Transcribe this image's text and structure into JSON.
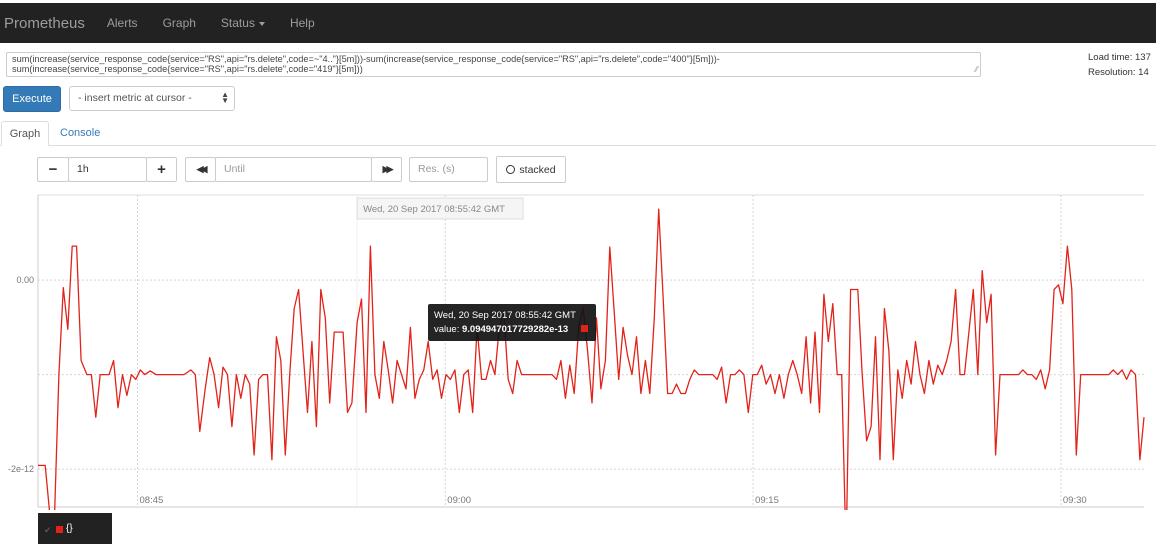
{
  "navbar": {
    "brand": "Prometheus",
    "items": [
      {
        "label": "Alerts"
      },
      {
        "label": "Graph"
      },
      {
        "label": "Status"
      },
      {
        "label": "Help"
      }
    ]
  },
  "query": {
    "line1": "sum(increase(service_response_code{service=\"RS\",api=\"rs.delete\",code=~\"4..\"}[5m]))-sum(increase(service_response_code{service=\"RS\",api=\"rs.delete\",code=\"400\"}[5m]))-",
    "line2": "sum(increase(service_response_code{service=\"RS\",api=\"rs.delete\",code=\"419\"}[5m]))",
    "load_time": "Load time: 137",
    "resolution": "Resolution: 14",
    "execute_label": "Execute",
    "insert_metric_label": "- insert metric at cursor -"
  },
  "tabs": {
    "graph": "Graph",
    "console": "Console"
  },
  "controls": {
    "minus": "−",
    "range": "1h",
    "plus": "+",
    "back": "◀◀",
    "until_placeholder": "Until",
    "forward": "▶▶",
    "res_placeholder": "Res. (s)",
    "stacked": "stacked"
  },
  "hover_header": "Wed, 20 Sep 2017 08:55:42 GMT",
  "tooltip": {
    "time": "Wed, 20 Sep 2017 08:55:42 GMT",
    "value_label": "value:",
    "value": "9.094947017729282e-13"
  },
  "legend": {
    "label": "{}",
    "color": "#e2231a"
  },
  "chart_data": {
    "type": "line",
    "series_color": "#e2231a",
    "x_range": [
      "08:40:09",
      "09:34:03"
    ],
    "ylim": [
      -2.4e-12,
      9e-13
    ],
    "y_ticks": [
      {
        "value": 0,
        "label": "0.00"
      },
      {
        "value": -2e-12,
        "label": "-2e-12"
      }
    ],
    "x_ticks": [
      {
        "time": "08:45:00",
        "label": "08:45"
      },
      {
        "time": "09:00:00",
        "label": "09:00"
      },
      {
        "time": "09:15:00",
        "label": "09:15"
      },
      {
        "time": "09:30:00",
        "label": "09:30"
      }
    ],
    "hover_time": "08:55:42",
    "points": [
      [
        "08:40:09",
        -1.96e-12
      ],
      [
        "08:40:30",
        -1.96e-12
      ],
      [
        "08:40:54",
        -2.88e-12
      ],
      [
        "08:41:10",
        -1e-12
      ],
      [
        "08:41:23",
        -8e-14
      ],
      [
        "08:41:36",
        -5.2e-13
      ],
      [
        "08:41:49",
        3.6e-13
      ],
      [
        "08:42:02",
        3.6e-13
      ],
      [
        "08:42:15",
        -8.5e-13
      ],
      [
        "08:42:32",
        -1e-12
      ],
      [
        "08:42:45",
        -1e-12
      ],
      [
        "08:42:58",
        -1.45e-12
      ],
      [
        "08:43:11",
        -1e-12
      ],
      [
        "08:43:24",
        -1e-12
      ],
      [
        "08:43:37",
        -1e-12
      ],
      [
        "08:43:50",
        -8.5e-13
      ],
      [
        "08:44:03",
        -1.35e-12
      ],
      [
        "08:44:16",
        -1e-12
      ],
      [
        "08:44:29",
        -1.22e-12
      ],
      [
        "08:44:42",
        -1e-12
      ],
      [
        "08:44:55",
        -1.05e-12
      ],
      [
        "08:45:08",
        -9.5e-13
      ],
      [
        "08:45:21",
        -1e-12
      ],
      [
        "08:45:37",
        -9.6e-13
      ],
      [
        "08:45:54",
        -1e-12
      ],
      [
        "08:46:35",
        -1e-12
      ],
      [
        "08:47:16",
        -1e-12
      ],
      [
        "08:47:36",
        -9.5e-13
      ],
      [
        "08:47:49",
        -1e-12
      ],
      [
        "08:48:02",
        -1.6e-12
      ],
      [
        "08:48:18",
        -1.15e-12
      ],
      [
        "08:48:31",
        -8.2e-13
      ],
      [
        "08:48:44",
        -1e-12
      ],
      [
        "08:48:57",
        -1.35e-12
      ],
      [
        "08:49:10",
        -9.2e-13
      ],
      [
        "08:49:23",
        -1e-12
      ],
      [
        "08:49:36",
        -1.55e-12
      ],
      [
        "08:49:49",
        -1e-12
      ],
      [
        "08:50:02",
        -1.25e-12
      ],
      [
        "08:50:15",
        -1e-12
      ],
      [
        "08:50:28",
        -1.1e-12
      ],
      [
        "08:50:41",
        -1.85e-12
      ],
      [
        "08:50:54",
        -1.05e-12
      ],
      [
        "08:51:07",
        -1e-12
      ],
      [
        "08:51:20",
        -1e-12
      ],
      [
        "08:51:33",
        -1.9e-12
      ],
      [
        "08:51:46",
        -6e-13
      ],
      [
        "08:51:59",
        -8.5e-13
      ],
      [
        "08:52:12",
        -1.85e-12
      ],
      [
        "08:52:25",
        -1e-12
      ],
      [
        "08:52:38",
        -3e-13
      ],
      [
        "08:52:51",
        -1e-13
      ],
      [
        "08:53:04",
        -7.5e-13
      ],
      [
        "08:53:17",
        -1.4e-12
      ],
      [
        "08:53:30",
        -6.5e-13
      ],
      [
        "08:53:43",
        -1.55e-12
      ],
      [
        "08:53:56",
        -1e-13
      ],
      [
        "08:54:09",
        -4e-13
      ],
      [
        "08:54:22",
        -1.3e-12
      ],
      [
        "08:54:35",
        -5.5e-13
      ],
      [
        "08:54:48",
        -5.5e-13
      ],
      [
        "08:55:01",
        -5.5e-13
      ],
      [
        "08:55:14",
        -1.4e-12
      ],
      [
        "08:55:27",
        -1.3e-12
      ],
      [
        "08:55:42",
        -4.5e-13
      ],
      [
        "08:55:55",
        -2e-13
      ],
      [
        "08:56:08",
        -1.4e-12
      ],
      [
        "08:56:21",
        3.6e-13
      ],
      [
        "08:56:34",
        -1e-12
      ],
      [
        "08:56:47",
        -1.25e-12
      ],
      [
        "08:57:00",
        -6.5e-13
      ],
      [
        "08:57:13",
        -9.5e-13
      ],
      [
        "08:57:26",
        -1.3e-12
      ],
      [
        "08:57:39",
        -8.5e-13
      ],
      [
        "08:57:52",
        -1e-12
      ],
      [
        "08:58:05",
        -1.15e-12
      ],
      [
        "08:58:18",
        -5e-13
      ],
      [
        "08:58:31",
        -1.25e-12
      ],
      [
        "08:58:44",
        -1.05e-12
      ],
      [
        "08:58:57",
        -9.5e-13
      ],
      [
        "08:59:10",
        -6.5e-13
      ],
      [
        "08:59:23",
        -1.05e-12
      ],
      [
        "08:59:36",
        -9.5e-13
      ],
      [
        "08:59:49",
        -1.25e-12
      ],
      [
        "09:00:02",
        -1e-12
      ],
      [
        "09:00:15",
        -1.05e-12
      ],
      [
        "09:00:28",
        -9.5e-13
      ],
      [
        "09:00:41",
        -1.4e-12
      ],
      [
        "09:00:54",
        -1e-12
      ],
      [
        "09:01:07",
        -9.5e-13
      ],
      [
        "09:01:20",
        -1.4e-12
      ],
      [
        "09:01:33",
        -5e-13
      ],
      [
        "09:01:46",
        -1.05e-12
      ],
      [
        "09:01:59",
        -1.05e-12
      ],
      [
        "09:02:12",
        -8.5e-13
      ],
      [
        "09:02:25",
        -1e-12
      ],
      [
        "09:02:38",
        -5e-13
      ],
      [
        "09:02:51",
        -3.5e-13
      ],
      [
        "09:03:04",
        -1.05e-12
      ],
      [
        "09:03:17",
        -1.2e-12
      ],
      [
        "09:03:30",
        -8.5e-13
      ],
      [
        "09:03:43",
        -1e-12
      ],
      [
        "09:03:56",
        -1e-12
      ],
      [
        "09:05:12",
        -1e-12
      ],
      [
        "09:05:25",
        -1.05e-12
      ],
      [
        "09:05:38",
        -8.5e-13
      ],
      [
        "09:05:51",
        -1.25e-12
      ],
      [
        "09:06:04",
        -9e-13
      ],
      [
        "09:06:17",
        -1.2e-12
      ],
      [
        "09:06:30",
        -5e-13
      ],
      [
        "09:06:43",
        -3e-13
      ],
      [
        "09:06:56",
        -7.5e-13
      ],
      [
        "09:07:09",
        -1.3e-12
      ],
      [
        "09:07:22",
        -4e-13
      ],
      [
        "09:07:35",
        -1.15e-12
      ],
      [
        "09:07:48",
        -8.5e-13
      ],
      [
        "09:08:01",
        3.5e-13
      ],
      [
        "09:08:14",
        -3.5e-13
      ],
      [
        "09:08:27",
        -1.05e-12
      ],
      [
        "09:08:40",
        -5e-13
      ],
      [
        "09:08:53",
        -8e-13
      ],
      [
        "09:09:06",
        -1e-12
      ],
      [
        "09:09:19",
        -6e-13
      ],
      [
        "09:09:32",
        -1.2e-12
      ],
      [
        "09:09:45",
        -8.5e-13
      ],
      [
        "09:09:58",
        -1.2e-12
      ],
      [
        "09:10:11",
        -4e-13
      ],
      [
        "09:10:24",
        7.5e-13
      ],
      [
        "09:10:37",
        -2e-13
      ],
      [
        "09:10:50",
        -1.2e-12
      ],
      [
        "09:11:03",
        -1.2e-12
      ],
      [
        "09:11:16",
        -1.1e-12
      ],
      [
        "09:11:29",
        -1.2e-12
      ],
      [
        "09:11:42",
        -1.2e-12
      ],
      [
        "09:11:55",
        -1.05e-12
      ],
      [
        "09:12:08",
        -9.5e-13
      ],
      [
        "09:12:21",
        -1e-12
      ],
      [
        "09:13:02",
        -1e-12
      ],
      [
        "09:13:15",
        -1.05e-12
      ],
      [
        "09:13:28",
        -9.2e-13
      ],
      [
        "09:13:41",
        -1.3e-12
      ],
      [
        "09:13:54",
        -1e-12
      ],
      [
        "09:14:07",
        -1e-12
      ],
      [
        "09:14:20",
        -9.5e-13
      ],
      [
        "09:14:33",
        -1e-12
      ],
      [
        "09:14:46",
        -1.4e-12
      ],
      [
        "09:14:59",
        -1e-12
      ],
      [
        "09:15:12",
        -1e-12
      ],
      [
        "09:15:25",
        -9e-13
      ],
      [
        "09:15:38",
        -1.1e-12
      ],
      [
        "09:15:51",
        -1e-12
      ],
      [
        "09:16:04",
        -1.2e-12
      ],
      [
        "09:16:17",
        -1e-12
      ],
      [
        "09:16:30",
        -1.25e-12
      ],
      [
        "09:16:43",
        -1e-12
      ],
      [
        "09:16:56",
        -8.5e-13
      ],
      [
        "09:17:09",
        -1e-12
      ],
      [
        "09:17:22",
        -1.2e-12
      ],
      [
        "09:17:35",
        -6e-13
      ],
      [
        "09:17:48",
        -1.3e-12
      ],
      [
        "09:18:01",
        -5.5e-13
      ],
      [
        "09:18:14",
        -1.4e-12
      ],
      [
        "09:18:27",
        -1.5e-13
      ],
      [
        "09:18:40",
        -6.5e-13
      ],
      [
        "09:18:53",
        -2.5e-13
      ],
      [
        "09:19:06",
        -1e-12
      ],
      [
        "09:19:19",
        -1e-12
      ],
      [
        "09:19:32",
        -2.9e-12
      ],
      [
        "09:19:45",
        -1e-13
      ],
      [
        "09:20:06",
        -1e-13
      ],
      [
        "09:20:19",
        -1e-12
      ],
      [
        "09:20:32",
        -1.7e-12
      ],
      [
        "09:20:45",
        -1.55e-12
      ],
      [
        "09:20:58",
        -6e-13
      ],
      [
        "09:21:11",
        -1.9e-12
      ],
      [
        "09:21:24",
        -3e-13
      ],
      [
        "09:21:37",
        -7.5e-13
      ],
      [
        "09:21:50",
        -1.9e-12
      ],
      [
        "09:22:03",
        -9.5e-13
      ],
      [
        "09:22:16",
        -1.25e-12
      ],
      [
        "09:22:29",
        -8.5e-13
      ],
      [
        "09:22:42",
        -1.1e-12
      ],
      [
        "09:22:55",
        -6.5e-13
      ],
      [
        "09:23:08",
        -1e-12
      ],
      [
        "09:23:21",
        -1.2e-12
      ],
      [
        "09:23:34",
        -8.5e-13
      ],
      [
        "09:23:47",
        -1.1e-12
      ],
      [
        "09:24:00",
        -9e-13
      ],
      [
        "09:24:13",
        -1e-12
      ],
      [
        "09:24:26",
        -8.5e-13
      ],
      [
        "09:24:39",
        -6.5e-13
      ],
      [
        "09:24:52",
        -1e-13
      ],
      [
        "09:25:05",
        -1e-12
      ],
      [
        "09:25:18",
        -1e-12
      ],
      [
        "09:25:31",
        -5.5e-13
      ],
      [
        "09:25:44",
        -1e-13
      ],
      [
        "09:25:57",
        -1e-12
      ],
      [
        "09:26:10",
        1e-13
      ],
      [
        "09:26:23",
        -4.5e-13
      ],
      [
        "09:26:36",
        -1.5e-13
      ],
      [
        "09:26:49",
        -1.85e-12
      ],
      [
        "09:27:02",
        -1e-12
      ],
      [
        "09:27:15",
        -1e-12
      ],
      [
        "09:27:56",
        -1e-12
      ],
      [
        "09:28:09",
        -9.5e-13
      ],
      [
        "09:28:22",
        -1e-12
      ],
      [
        "09:28:35",
        -1e-12
      ],
      [
        "09:28:48",
        -1.05e-12
      ],
      [
        "09:29:01",
        -9.5e-13
      ],
      [
        "09:29:14",
        -1.15e-12
      ],
      [
        "09:29:27",
        -9.5e-13
      ],
      [
        "09:29:40",
        -1e-13
      ],
      [
        "09:29:53",
        -5e-14
      ],
      [
        "09:30:06",
        -2.5e-13
      ],
      [
        "09:30:19",
        3.6e-13
      ],
      [
        "09:30:32",
        -1e-13
      ],
      [
        "09:30:45",
        -1.85e-12
      ],
      [
        "09:30:58",
        -1e-12
      ],
      [
        "09:31:39",
        -1e-12
      ],
      [
        "09:32:20",
        -1e-12
      ],
      [
        "09:32:33",
        -9.5e-13
      ],
      [
        "09:32:46",
        -1e-12
      ],
      [
        "09:32:59",
        -9.5e-13
      ],
      [
        "09:33:12",
        -1.05e-12
      ],
      [
        "09:33:25",
        -9.5e-13
      ],
      [
        "09:33:38",
        -1e-12
      ],
      [
        "09:33:51",
        -1.9e-12
      ],
      [
        "09:34:03",
        -1.45e-12
      ]
    ]
  }
}
